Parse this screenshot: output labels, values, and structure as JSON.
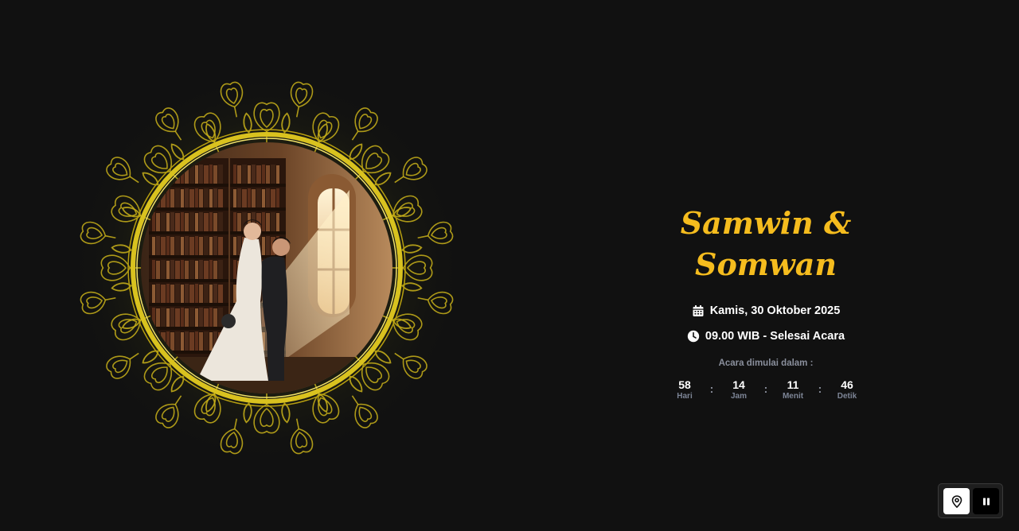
{
  "colors": {
    "background": "#111111",
    "accent_gold": "#F5BC1E",
    "ornament_gold": "#C9B21A",
    "muted_text": "#8a8f9c"
  },
  "hero": {
    "couple_names": "Samwin & Somwan",
    "photo_icon": "couple-photo",
    "ornament": "gold-floral-mandala-frame"
  },
  "event": {
    "date_icon": "calendar-icon",
    "date": "Kamis, 30 Oktober 2025",
    "time_icon": "clock-icon",
    "time": "09.00 WIB - Selesai Acara"
  },
  "countdown": {
    "label": "Acara dimulai dalam :",
    "separator": ":",
    "units": [
      {
        "value": "58",
        "label": "Hari"
      },
      {
        "value": "14",
        "label": "Jam"
      },
      {
        "value": "11",
        "label": "Menit"
      },
      {
        "value": "46",
        "label": "Detik"
      }
    ]
  },
  "controls": {
    "location_icon": "map-pin-icon",
    "pause_icon": "pause-icon"
  }
}
